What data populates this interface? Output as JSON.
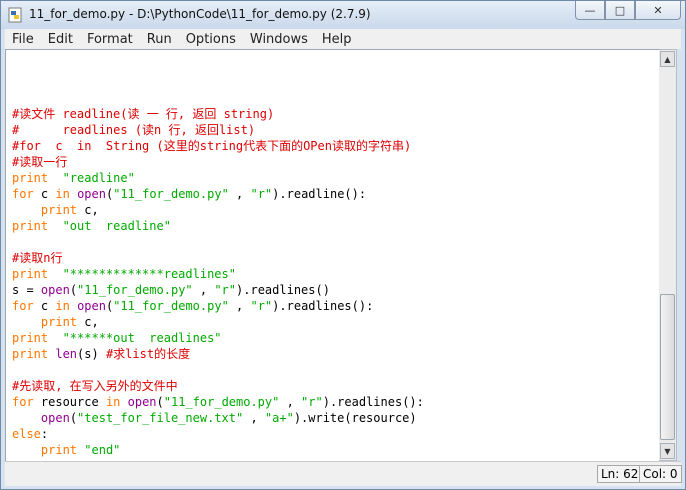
{
  "window": {
    "title": "11_for_demo.py - D:\\PythonCode\\11_for_demo.py (2.7.9)",
    "minimize": "—",
    "maximize": "□",
    "close": "✕"
  },
  "menubar": [
    "File",
    "Edit",
    "Format",
    "Run",
    "Options",
    "Windows",
    "Help"
  ],
  "code": [
    [
      {
        "t": "#读文件 readline(读 一 行, 返回 string)",
        "c": "cm"
      }
    ],
    [
      {
        "t": "#      readlines (读n 行, 返回list)",
        "c": "cm"
      }
    ],
    [
      {
        "t": "#for  c  in  String (这里的string代表下面的OPen读取的字符串)",
        "c": "cm"
      }
    ],
    [
      {
        "t": "#读取一行",
        "c": "cm"
      }
    ],
    [
      {
        "t": "print",
        "c": "kw"
      },
      {
        "t": "  ",
        "c": "pl"
      },
      {
        "t": "\"readline\"",
        "c": "str"
      }
    ],
    [
      {
        "t": "for",
        "c": "kw"
      },
      {
        "t": " c ",
        "c": "pl"
      },
      {
        "t": "in",
        "c": "kw"
      },
      {
        "t": " ",
        "c": "pl"
      },
      {
        "t": "open",
        "c": "bi"
      },
      {
        "t": "(",
        "c": "pl"
      },
      {
        "t": "\"11_for_demo.py\"",
        "c": "str"
      },
      {
        "t": " , ",
        "c": "pl"
      },
      {
        "t": "\"r\"",
        "c": "str"
      },
      {
        "t": ").readline():",
        "c": "pl"
      }
    ],
    [
      {
        "t": "    ",
        "c": "pl"
      },
      {
        "t": "print",
        "c": "kw"
      },
      {
        "t": " c,",
        "c": "pl"
      }
    ],
    [
      {
        "t": "print",
        "c": "kw"
      },
      {
        "t": "  ",
        "c": "pl"
      },
      {
        "t": "\"out  readline\"",
        "c": "str"
      }
    ],
    [
      {
        "t": "",
        "c": "pl"
      }
    ],
    [
      {
        "t": "#读取n行",
        "c": "cm"
      }
    ],
    [
      {
        "t": "print",
        "c": "kw"
      },
      {
        "t": "  ",
        "c": "pl"
      },
      {
        "t": "\"*************readlines\"",
        "c": "str"
      }
    ],
    [
      {
        "t": "s = ",
        "c": "pl"
      },
      {
        "t": "open",
        "c": "bi"
      },
      {
        "t": "(",
        "c": "pl"
      },
      {
        "t": "\"11_for_demo.py\"",
        "c": "str"
      },
      {
        "t": " , ",
        "c": "pl"
      },
      {
        "t": "\"r\"",
        "c": "str"
      },
      {
        "t": ").readlines()",
        "c": "pl"
      }
    ],
    [
      {
        "t": "for",
        "c": "kw"
      },
      {
        "t": " c ",
        "c": "pl"
      },
      {
        "t": "in",
        "c": "kw"
      },
      {
        "t": " ",
        "c": "pl"
      },
      {
        "t": "open",
        "c": "bi"
      },
      {
        "t": "(",
        "c": "pl"
      },
      {
        "t": "\"11_for_demo.py\"",
        "c": "str"
      },
      {
        "t": " , ",
        "c": "pl"
      },
      {
        "t": "\"r\"",
        "c": "str"
      },
      {
        "t": ").readlines():",
        "c": "pl"
      }
    ],
    [
      {
        "t": "    ",
        "c": "pl"
      },
      {
        "t": "print",
        "c": "kw"
      },
      {
        "t": " c,",
        "c": "pl"
      }
    ],
    [
      {
        "t": "print",
        "c": "kw"
      },
      {
        "t": "  ",
        "c": "pl"
      },
      {
        "t": "\"******out  readlines\"",
        "c": "str"
      }
    ],
    [
      {
        "t": "print",
        "c": "kw"
      },
      {
        "t": " ",
        "c": "pl"
      },
      {
        "t": "len",
        "c": "bi"
      },
      {
        "t": "(s) ",
        "c": "pl"
      },
      {
        "t": "#求list的长度",
        "c": "cm"
      }
    ],
    [
      {
        "t": "",
        "c": "pl"
      }
    ],
    [
      {
        "t": "#先读取, 在写入另外的文件中",
        "c": "cm"
      }
    ],
    [
      {
        "t": "for",
        "c": "kw"
      },
      {
        "t": " resource ",
        "c": "pl"
      },
      {
        "t": "in",
        "c": "kw"
      },
      {
        "t": " ",
        "c": "pl"
      },
      {
        "t": "open",
        "c": "bi"
      },
      {
        "t": "(",
        "c": "pl"
      },
      {
        "t": "\"11_for_demo.py\"",
        "c": "str"
      },
      {
        "t": " , ",
        "c": "pl"
      },
      {
        "t": "\"r\"",
        "c": "str"
      },
      {
        "t": ").readlines():",
        "c": "pl"
      }
    ],
    [
      {
        "t": "    ",
        "c": "pl"
      },
      {
        "t": "open",
        "c": "bi"
      },
      {
        "t": "(",
        "c": "pl"
      },
      {
        "t": "\"test_for_file_new.txt\"",
        "c": "str"
      },
      {
        "t": " , ",
        "c": "pl"
      },
      {
        "t": "\"a+\"",
        "c": "str"
      },
      {
        "t": ").write(resource)",
        "c": "pl"
      }
    ],
    [
      {
        "t": "else",
        "c": "kw"
      },
      {
        "t": ":",
        "c": "pl"
      }
    ],
    [
      {
        "t": "    ",
        "c": "pl"
      },
      {
        "t": "print",
        "c": "kw"
      },
      {
        "t": " ",
        "c": "pl"
      },
      {
        "t": "\"end\"",
        "c": "str"
      }
    ]
  ],
  "status": {
    "line": "Ln: 62",
    "col": "Col: 0"
  }
}
